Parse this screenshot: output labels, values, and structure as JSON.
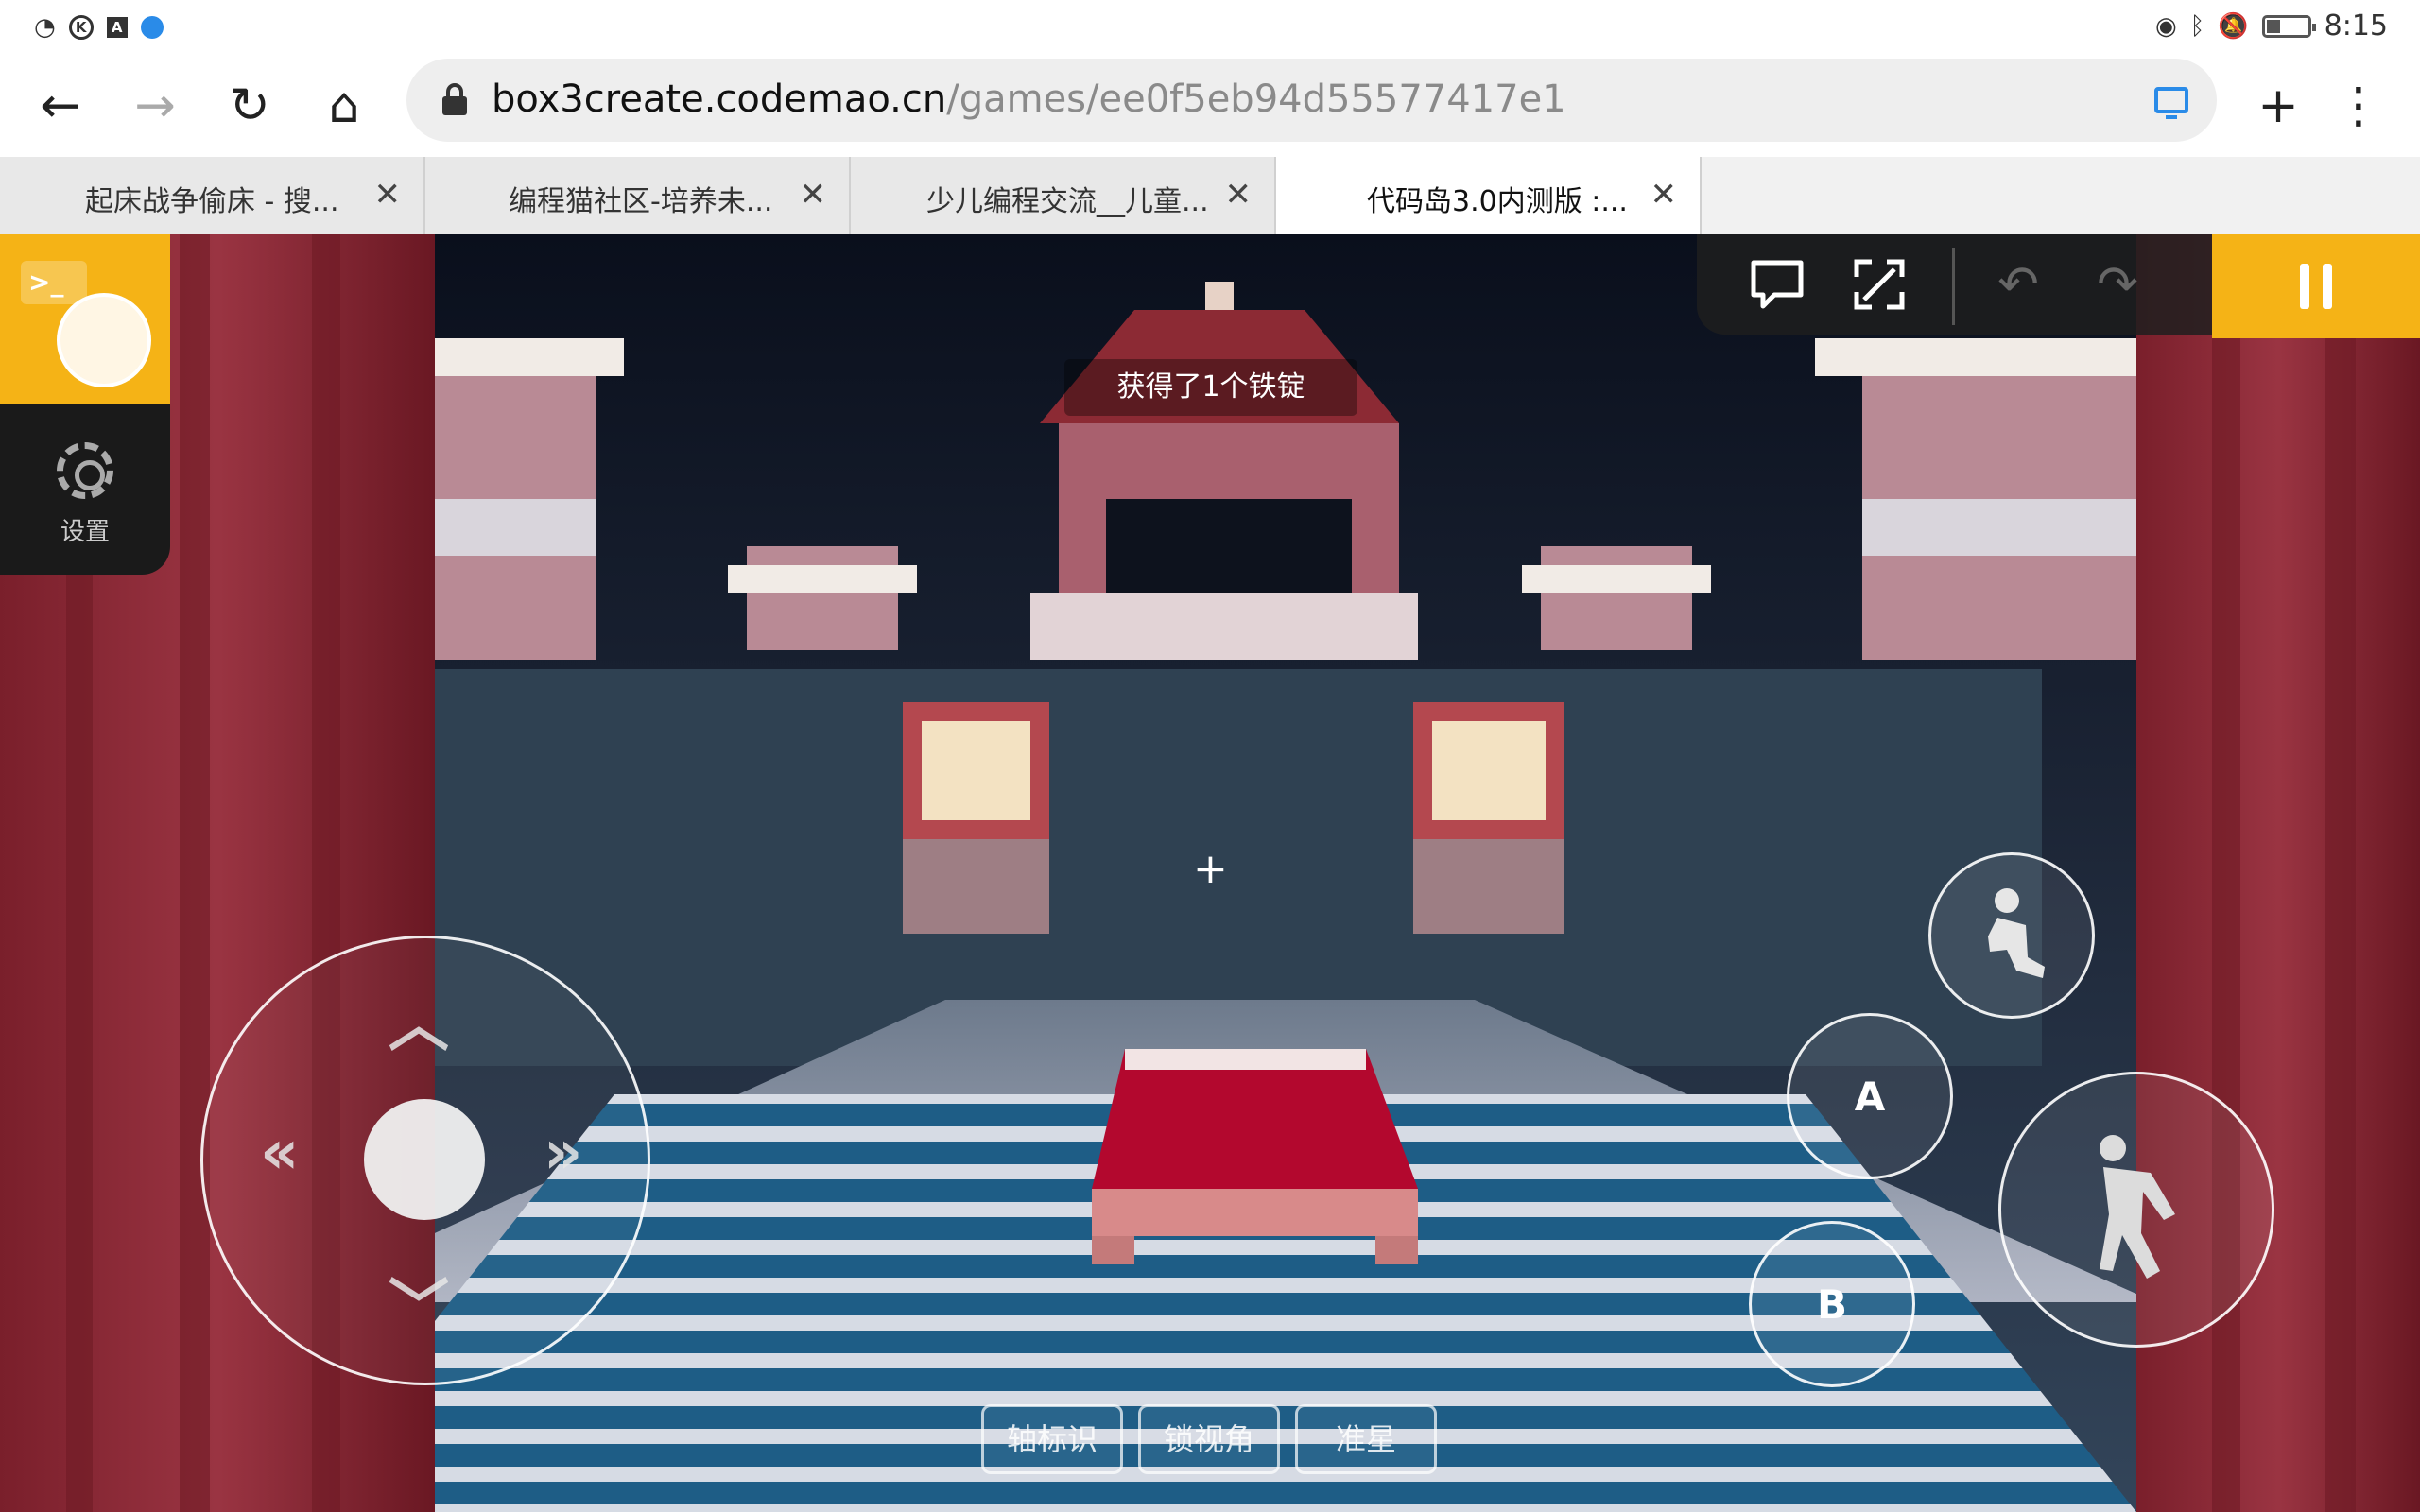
{
  "status_bar": {
    "time": "8:15",
    "icons": [
      "wifi-icon",
      "k-app-icon",
      "a-app-icon",
      "blue-app-icon",
      "eye-icon",
      "bluetooth-icon",
      "mute-icon",
      "battery-icon"
    ]
  },
  "browser": {
    "url_host": "box3create.codemao.cn",
    "url_path": "/games/ee0f5eb94d55577417e1",
    "tabs": [
      {
        "title": "起床战争偷床 - 搜..."
      },
      {
        "title": "编程猫社区-培养未..."
      },
      {
        "title": "少儿编程交流__儿童..."
      },
      {
        "title": "代码岛3.0内测版 :..."
      }
    ],
    "active_tab_index": 3
  },
  "game": {
    "settings_label": "设置",
    "toast": "获得了1个铁锭",
    "buttons": {
      "a": "A",
      "b": "B"
    },
    "bottom_buttons": [
      {
        "label": "轴标识"
      },
      {
        "label": "锁视角"
      },
      {
        "label": "准星"
      }
    ],
    "colors": {
      "accent": "#f5b316",
      "curtain": "#8b2a35",
      "sky": "#0f1626",
      "bed": "#b3082e"
    }
  }
}
